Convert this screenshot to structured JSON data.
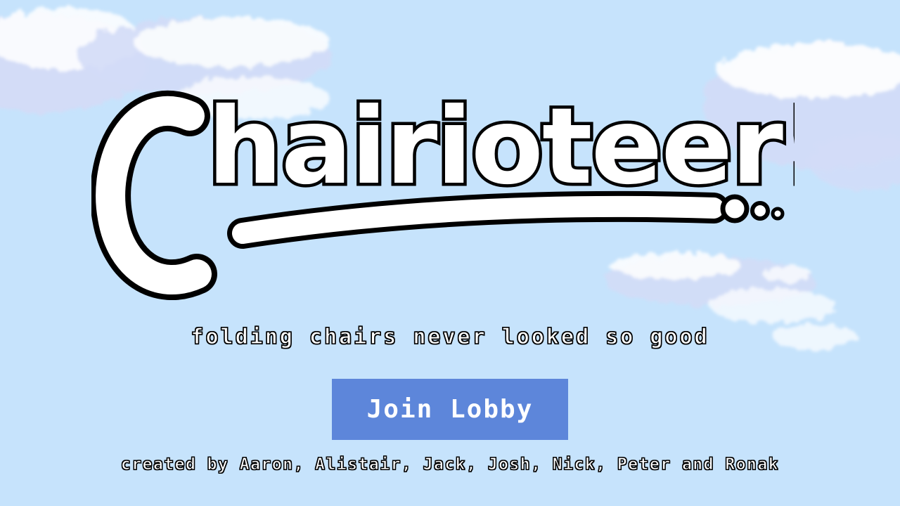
{
  "background": {
    "sky_color": "#c6e3fc",
    "cloud_color": "#ffffff",
    "cloud_shadow": "#d3dcf7"
  },
  "logo": {
    "text": "Chairioteer!",
    "fill": "#ffffff",
    "outline": "#000000"
  },
  "tagline": "folding chairs never looked so good",
  "join_button": {
    "label": "Join Lobby",
    "color": "#5d86da"
  },
  "credits": "created by Aaron, Alistair, Jack, Josh, Nick, Peter and Ronak"
}
